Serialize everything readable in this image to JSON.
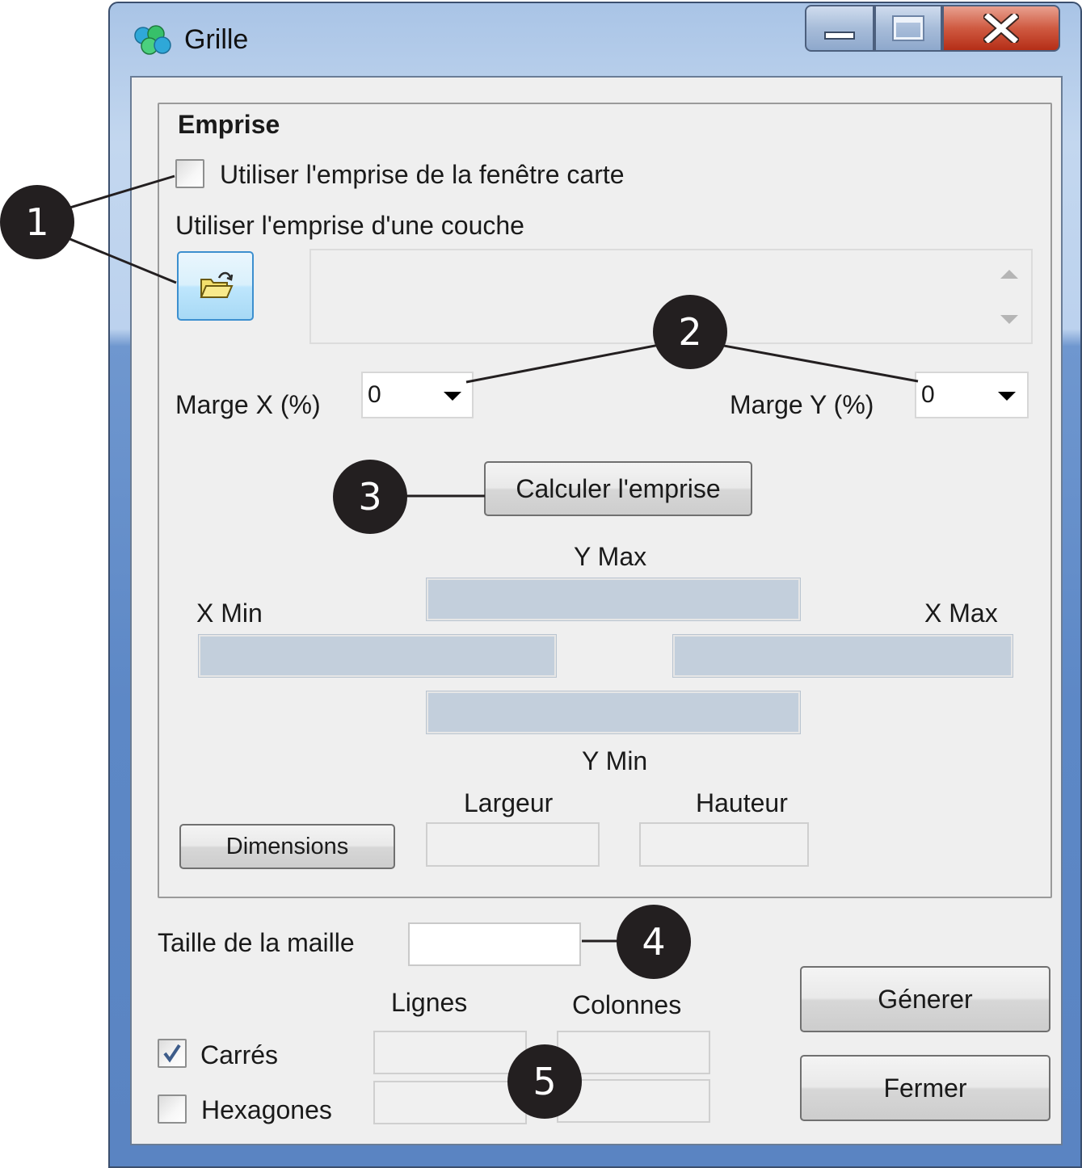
{
  "window": {
    "title": "Grille"
  },
  "emprise": {
    "group_title": "Emprise",
    "use_map_extent_label": "Utiliser l'emprise de la  fenêtre carte",
    "use_map_extent_checked": false,
    "use_layer_extent_label": "Utiliser l'emprise d'une couche",
    "layer_list_value": "",
    "margin_x_label": "Marge  X (%)",
    "margin_x_value": "0",
    "margin_y_label": "Marge  Y (%)",
    "margin_y_value": "0",
    "calculate_label": "Calculer l'emprise",
    "ymax_label": "Y Max",
    "xmin_label": "X Min",
    "xmax_label": "X Max",
    "ymin_label": "Y Min",
    "ymax_value": "",
    "xmin_value": "",
    "xmax_value": "",
    "ymin_value": "",
    "dimensions_label": "Dimensions",
    "width_label": "Largeur",
    "height_label": "Hauteur",
    "width_value": "",
    "height_value": ""
  },
  "grid": {
    "cell_size_label": "Taille de la maille",
    "cell_size_value": "",
    "rows_label": "Lignes",
    "cols_label": "Colonnes",
    "squares_label": "Carrés",
    "squares_checked": true,
    "hexagons_label": "Hexagones",
    "hexagons_checked": false,
    "squares_rows_value": "",
    "squares_cols_value": "",
    "hexagons_rows_value": "",
    "hexagons_cols_value": ""
  },
  "actions": {
    "generate_label": "Génerer",
    "close_label": "Fermer"
  },
  "callouts": [
    "1",
    "2",
    "3",
    "4",
    "5"
  ],
  "colors": {
    "callout_fill": "#231f20",
    "callout_text": "#ffffff",
    "readonly_field": "#c3cfdc",
    "dialog_bg": "#efefef"
  },
  "icons": {
    "app": "grid-app-icon",
    "open_folder": "open-folder-icon",
    "minimize": "minimize-icon",
    "maximize": "maximize-icon",
    "close": "close-icon",
    "checkmark": "checkmark-icon",
    "dropdown": "dropdown-arrow-icon"
  }
}
